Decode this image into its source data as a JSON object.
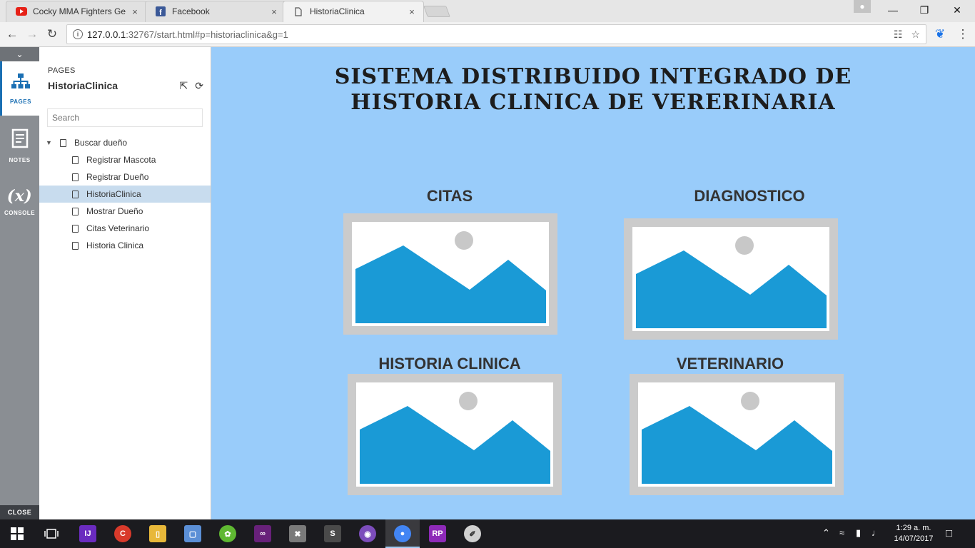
{
  "browser": {
    "tabs": [
      {
        "title": "Cocky MMA Fighters Get",
        "icon": "youtube-icon",
        "close": "×"
      },
      {
        "title": "Facebook",
        "icon": "facebook-icon",
        "close": "×"
      },
      {
        "title": "HistoriaClinica",
        "icon": "page-icon",
        "close": "×"
      }
    ],
    "url_host": "127.0.0.1",
    "url_rest": ":32767/start.html#p=historiaclinica&g=1",
    "window_controls": {
      "minimize": "—",
      "maximize": "❐",
      "close": "✕"
    }
  },
  "rail": {
    "collapse": "⌄",
    "pages_label": "PAGES",
    "notes_label": "NOTES",
    "console_label": "CONSOLE",
    "console_glyph": "(x)",
    "close_label": "CLOSE"
  },
  "panel": {
    "section_label": "PAGES",
    "project_title": "HistoriaClinica",
    "search_placeholder": "Search",
    "tree": {
      "root": "Buscar dueño",
      "children": [
        "Registrar Mascota",
        "Registrar Dueño",
        "HistoriaClinica",
        "Mostrar Dueño",
        "Citas Veterinario",
        "Historia Clinica"
      ]
    }
  },
  "canvas": {
    "title_line1": "SISTEMA DISTRIBUIDO INTEGRADO DE",
    "title_line2": "HISTORIA CLINICA DE VERERINARIA",
    "tiles": [
      "CITAS",
      "DIAGNOSTICO",
      "HISTORIA CLINICA",
      "VETERINARIO"
    ]
  },
  "taskbar": {
    "time": "1:29 a. m.",
    "date": "14/07/2017"
  },
  "colors": {
    "canvas_bg": "#99ccfa",
    "placeholder_frame": "#cbcbcb",
    "mountain": "#1a9ad6",
    "sun": "#c8c8c8",
    "selected_row": "#c8dcee"
  }
}
